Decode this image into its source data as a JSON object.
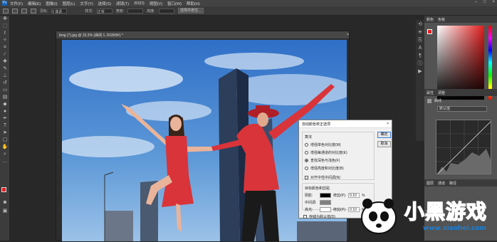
{
  "menu": {
    "logo": "Ps",
    "items": [
      "文件(F)",
      "编辑(E)",
      "图像(I)",
      "图层(L)",
      "文字(Y)",
      "选择(S)",
      "滤镜(T)",
      "3D(D)",
      "视图(V)",
      "窗口(W)",
      "帮助(H)"
    ]
  },
  "options": {
    "feather_label": "羽化:",
    "feather_value": "0 像素",
    "style_label": "样式:",
    "style_value": "正常",
    "width_label": "宽度:",
    "height_label": "高度:",
    "refine_btn": "选择并遮住..."
  },
  "document": {
    "tab_title": "timg (7).jpg @ 33.3% (曲线 1, RGB/8#) *",
    "close": "×"
  },
  "panels": {
    "color_tab": "颜色",
    "swatch_tab": "色板",
    "props_tab": "属性",
    "adjust_tab": "调整",
    "curves_label": "曲线",
    "preset": "默认值",
    "layers_tab": "图层",
    "channels_tab": "通道",
    "paths_tab": "路径"
  },
  "dialog": {
    "title": "自动颜色校正选项",
    "close": "×",
    "algo_label": "算法",
    "options": [
      "增强单色对比度(M)",
      "增强每通道的对比度(E)",
      "查找深色与浅色(F)",
      "增强亮度和对比度(B)"
    ],
    "selected_index": 2,
    "snap_label": "对齐中性中间调(N)",
    "targets_label": "目标颜色和剪贴",
    "shadows_label": "阴影:",
    "midtones_label": "中间调:",
    "highlights_label": "高光:",
    "clip_label": "修剪(P):",
    "clip_shadow": "0.10",
    "clip_highlight": "0.10",
    "pct": "%",
    "ok": "确定",
    "cancel": "取消",
    "save_default": "存储为默认值(D)"
  },
  "watermark": {
    "brand": "小黑游戏",
    "url": "www.xiaohei.com"
  },
  "colors": {
    "foreground": "#e21d1d",
    "background": "#111111",
    "dress": "#d9343a"
  }
}
